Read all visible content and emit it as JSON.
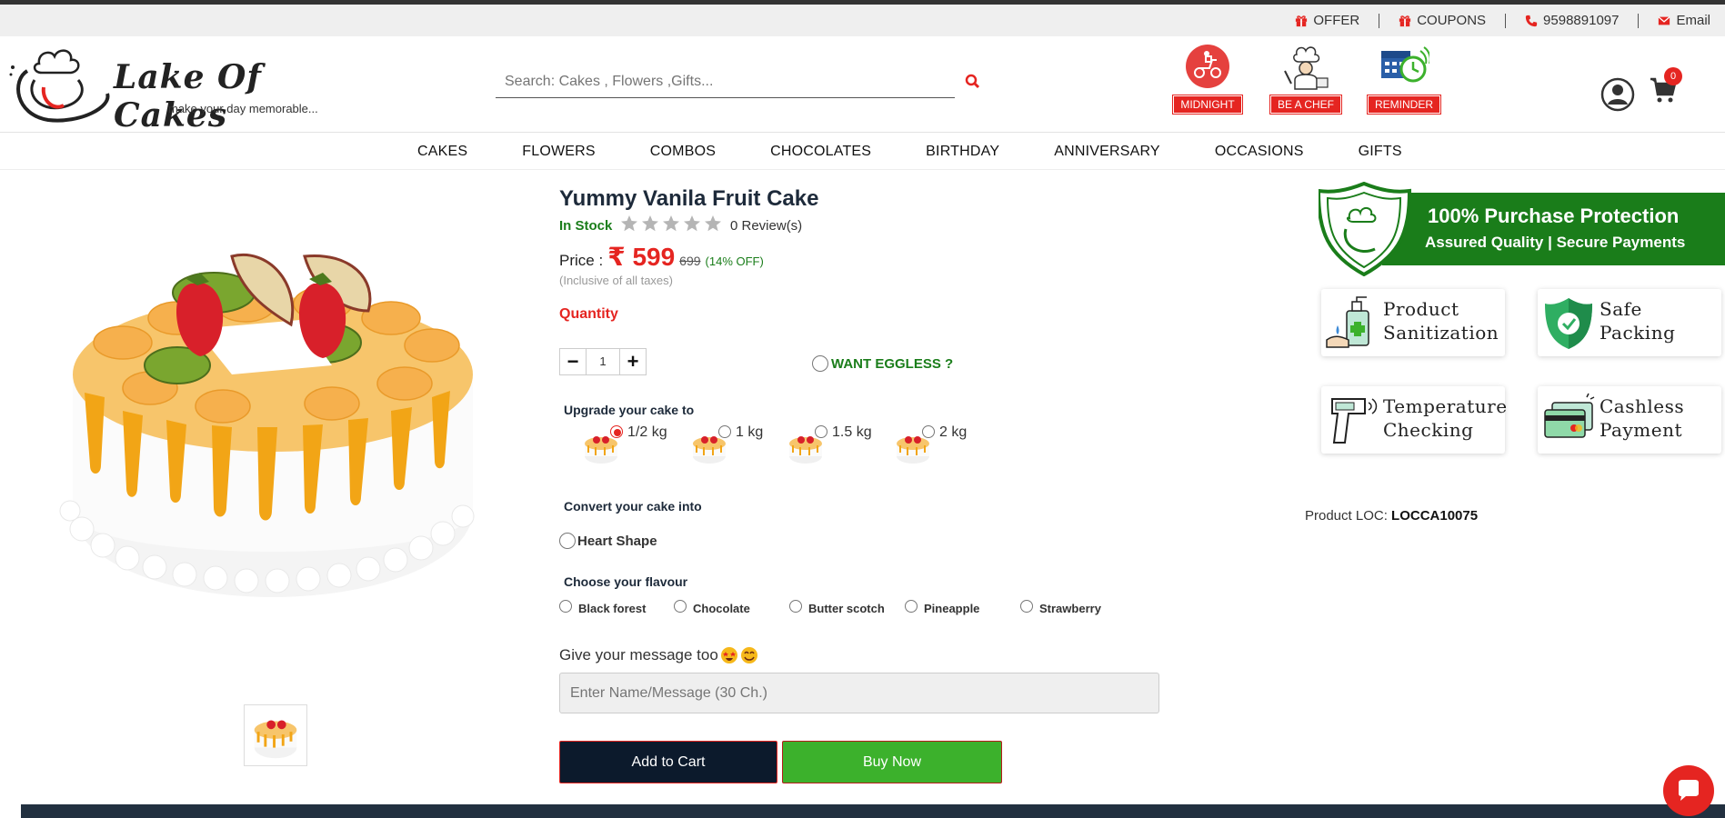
{
  "topbar": {
    "offer": "OFFER",
    "coupons": "COUPONS",
    "phone": "9598891097",
    "email": "Email"
  },
  "logo": {
    "title": "Lake Of Cakes",
    "tagline": "make your day memorable..."
  },
  "search": {
    "placeholder": "Search: Cakes , Flowers ,Gifts..."
  },
  "features": [
    {
      "label": "MIDNIGHT",
      "icon": "delivery-scooter-icon"
    },
    {
      "label": "BE A CHEF",
      "icon": "chef-icon"
    },
    {
      "label": "REMINDER",
      "icon": "calendar-clock-icon"
    }
  ],
  "cart": {
    "count": "0"
  },
  "nav": [
    "CAKES",
    "FLOWERS",
    "COMBOS",
    "CHOCOLATES",
    "BIRTHDAY",
    "ANNIVERSARY",
    "OCCASIONS",
    "GIFTS"
  ],
  "product": {
    "title": "Yummy Vanila Fruit Cake",
    "stock": "In Stock",
    "rating": 0,
    "reviews": "0 Review(s)",
    "price_label": "Price :",
    "currency": "₹",
    "price": "599",
    "old_price": "699",
    "discount": "(14% OFF)",
    "taxes": "(Inclusive of all taxes)",
    "quantity_label": "Quantity",
    "quantity": "1",
    "eggless": "WANT EGGLESS ?",
    "upgrade_label": "Upgrade your cake to",
    "sizes": [
      {
        "label": "1/2 kg",
        "selected": true
      },
      {
        "label": "1 kg",
        "selected": false
      },
      {
        "label": "1.5 kg",
        "selected": false
      },
      {
        "label": "2 kg",
        "selected": false
      }
    ],
    "convert_label": "Convert your cake into",
    "heart_shape": "Heart Shape",
    "flavour_label": "Choose your flavour",
    "flavours": [
      "Black forest",
      "Chocolate",
      "Butter scotch",
      "Pineapple",
      "Strawberry"
    ],
    "message_label": "Give your message too",
    "message_placeholder": "Enter Name/Message (30 Ch.)",
    "add_to_cart": "Add to Cart",
    "buy_now": "Buy Now",
    "loc_label": "Product LOC:",
    "loc_code": "LOCCA10075"
  },
  "protection": {
    "title": "100% Purchase Protection",
    "subtitle": "Assured Quality | Secure Payments"
  },
  "badges": [
    {
      "line1": "Product",
      "line2": "Sanitization",
      "icon": "sanitizer-icon"
    },
    {
      "line1": "Safe",
      "line2": "Packing",
      "icon": "shield-check-icon"
    },
    {
      "line1": "Temperature",
      "line2": "Checking",
      "icon": "thermometer-gun-icon"
    },
    {
      "line1": "Cashless",
      "line2": "Payment",
      "icon": "credit-card-icon"
    }
  ],
  "colors": {
    "accent": "#e52521",
    "success": "#1a7d1a",
    "dark": "#0c1a2c",
    "buy": "#3cb12c"
  }
}
